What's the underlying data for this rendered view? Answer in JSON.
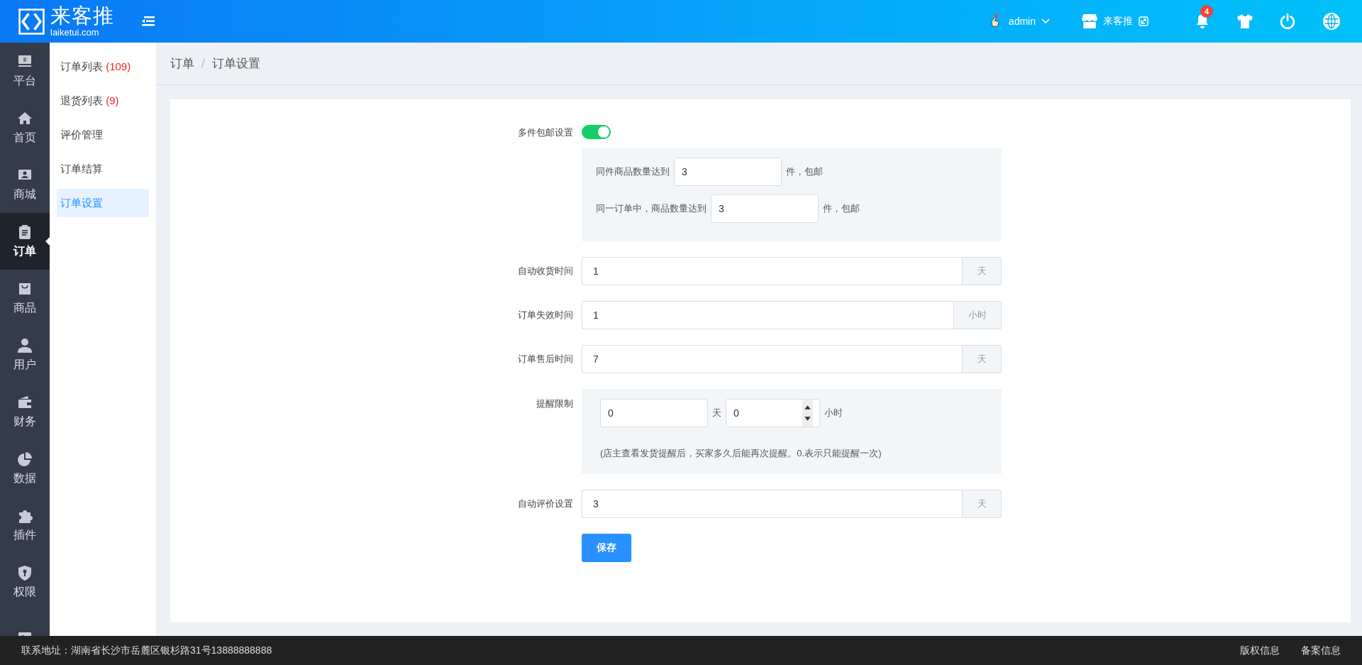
{
  "header": {
    "logo_name": "来客推",
    "logo_domain": "laiketui.com",
    "user": "admin",
    "store": "来客推",
    "notifications": "4"
  },
  "nav": [
    {
      "label": "平台",
      "selected": false
    },
    {
      "label": "首页",
      "selected": false
    },
    {
      "label": "商城",
      "selected": false
    },
    {
      "label": "订单",
      "selected": true
    },
    {
      "label": "商品",
      "selected": false
    },
    {
      "label": "用户",
      "selected": false
    },
    {
      "label": "财务",
      "selected": false
    },
    {
      "label": "数据",
      "selected": false
    },
    {
      "label": "插件",
      "selected": false
    },
    {
      "label": "权限",
      "selected": false
    },
    {
      "selected": false
    }
  ],
  "submenu": [
    {
      "label": "订单列表",
      "count": "(109)",
      "selected": false
    },
    {
      "label": "退货列表",
      "count": "(9)",
      "selected": false
    },
    {
      "label": "评价管理",
      "selected": false
    },
    {
      "label": "订单结算",
      "selected": false
    },
    {
      "label": "订单设置",
      "selected": true
    }
  ],
  "breadcrumb": {
    "items": [
      "订单",
      "订单设置"
    ],
    "separator": "/"
  },
  "form": {
    "rows": [
      {
        "kind": "toggle",
        "label": "多件包邮设置",
        "on": true,
        "rules": [
          {
            "prefix": "同件商品数量达到",
            "value": "3",
            "suffix": "件，包邮"
          },
          {
            "prefix": "同一订单中，商品数量达到",
            "value": "3",
            "suffix": "件，包邮"
          }
        ]
      },
      {
        "kind": "addon",
        "label": "自动收货时间",
        "value": "1",
        "unit": "天"
      },
      {
        "kind": "addon",
        "label": "订单失效时间",
        "value": "1",
        "unit": "小时"
      },
      {
        "kind": "addon",
        "label": "订单售后时间",
        "value": "7",
        "unit": "天"
      },
      {
        "kind": "reminder",
        "label": "提醒限制",
        "days": "0",
        "days_unit": "天",
        "hours": "0",
        "hours_unit": "小时",
        "note": "(店主查看发货提醒后，买家多久后能再次提醒。0.表示只能提醒一次)"
      },
      {
        "kind": "addon",
        "label": "自动评价设置",
        "value": "3",
        "unit": "天"
      }
    ],
    "save": "保存"
  },
  "footer": {
    "address": "联系地址：湖南省长沙市岳麓区银杉路31号13888888888",
    "links": [
      "版权信息",
      "备案信息"
    ]
  }
}
